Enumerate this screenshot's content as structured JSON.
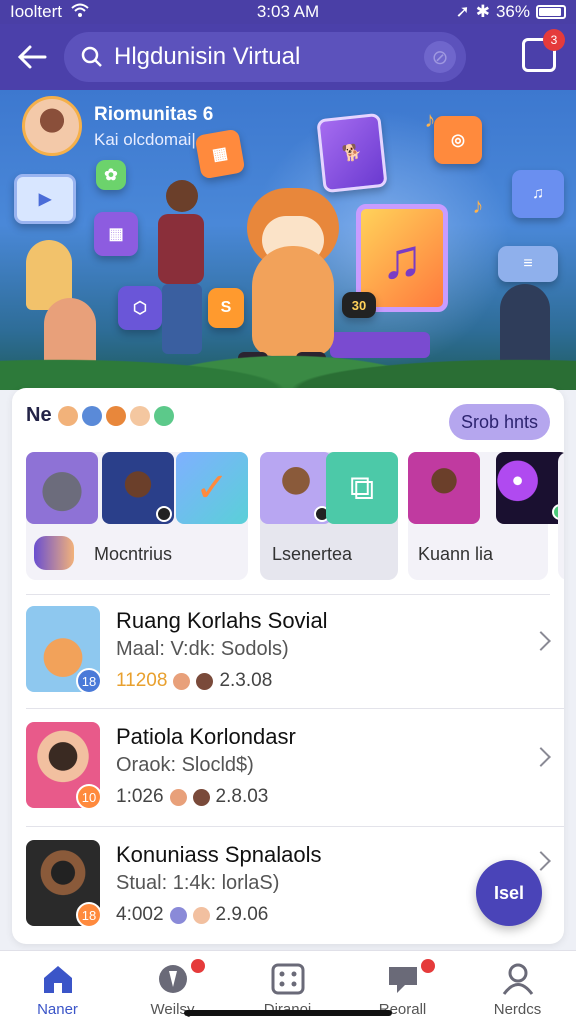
{
  "status_bar": {
    "carrier": "Iooltert",
    "time": "3:03 AM",
    "battery": "36%"
  },
  "header": {
    "search_text": "Hlgdunisin Virtual",
    "notification_count": "3"
  },
  "banner": {
    "title": "Riomunitas 6",
    "subtitle": "Kai olcdomai|",
    "player_glyph": "♫",
    "chips": [
      "S",
      "30"
    ]
  },
  "section": {
    "title": "Ne",
    "see_all_label": "Srob hnts"
  },
  "featured_tiles": [
    {
      "label": "Mocntrius"
    },
    {
      "label": "Lsenertea"
    },
    {
      "label": "Kuann lia"
    }
  ],
  "list_items": [
    {
      "title": "Ruang Korlahs Sovial",
      "subtitle": "Maal: V:dk: Sodols)",
      "count": "11208",
      "rating": "2.3.08",
      "badge": "18"
    },
    {
      "title": "Patiola Korlondasr",
      "subtitle": "Oraok: Slocld$)",
      "count": "1:026",
      "rating": "2.8.03",
      "badge": "10"
    },
    {
      "title": "Konuniass Spnalaols",
      "subtitle": "Stual: 1:4k: lorlaS)",
      "count": "4:002",
      "rating": "2.9.06",
      "badge": "18"
    }
  ],
  "fab_label": "Isel",
  "bottom_nav": [
    {
      "label": "Naner",
      "icon": "home-icon",
      "active": true
    },
    {
      "label": "Weilsy",
      "icon": "badge-icon",
      "active": false
    },
    {
      "label": "Diranoi",
      "icon": "grid-icon",
      "active": false
    },
    {
      "label": "Reorall",
      "icon": "chat-icon",
      "active": false
    },
    {
      "label": "Nerdcs",
      "icon": "profile-icon",
      "active": false
    }
  ],
  "colors": {
    "primary": "#4b40aa",
    "accent": "#b5a6ee",
    "badge": "#e53b3b",
    "fab": "#4a44b8"
  }
}
